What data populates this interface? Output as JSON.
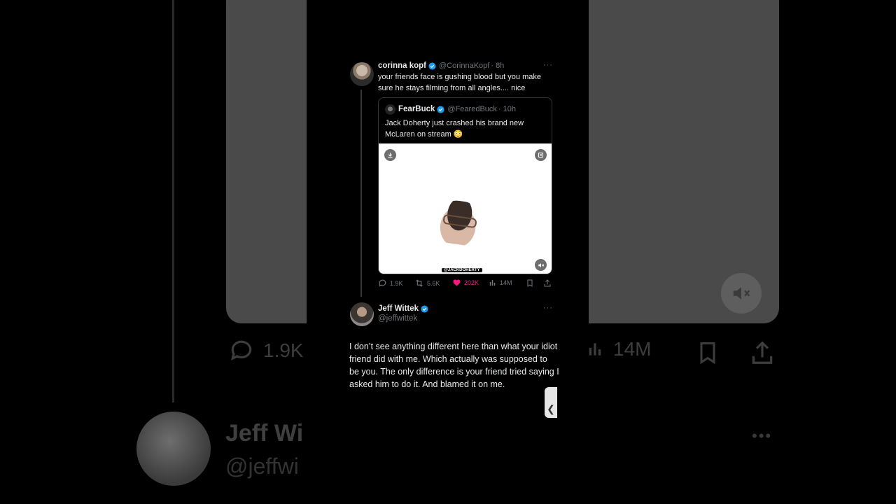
{
  "background": {
    "stats": {
      "replies": "1.9K",
      "views": "14M"
    },
    "name": "Jeff Wi",
    "handle": "@jeffwi"
  },
  "tweet": {
    "author_name": "corinna kopf",
    "author_handle": "@CorinnaKopf",
    "time": "· 8h",
    "text": "your friends face is gushing blood but you make sure he stays filming from all angles.... nice",
    "more": "···"
  },
  "quote": {
    "author_name": "FearBuck",
    "author_handle": "@FearedBuck",
    "time": "· 10h",
    "text": "Jack Doherty just crashed his brand new McLaren on stream 😳",
    "watermark": "@JACKDOHERTY"
  },
  "actions": {
    "replies": "1.9K",
    "reposts": "5.6K",
    "likes": "202K",
    "views": "14M"
  },
  "reply": {
    "author_name": "Jeff Wittek",
    "author_handle": "@jeffwittek",
    "more": "···",
    "text": "I don’t see anything different here than what your idiot friend did with me. Which actually was supposed to be you. The only difference is your friend tried saying I asked him to do it. And blamed it on me."
  },
  "colors": {
    "background": "#000000",
    "verified": "#1d9bf0",
    "like": "#f91880",
    "muted_text": "#71767b"
  },
  "side_tab": "❮"
}
